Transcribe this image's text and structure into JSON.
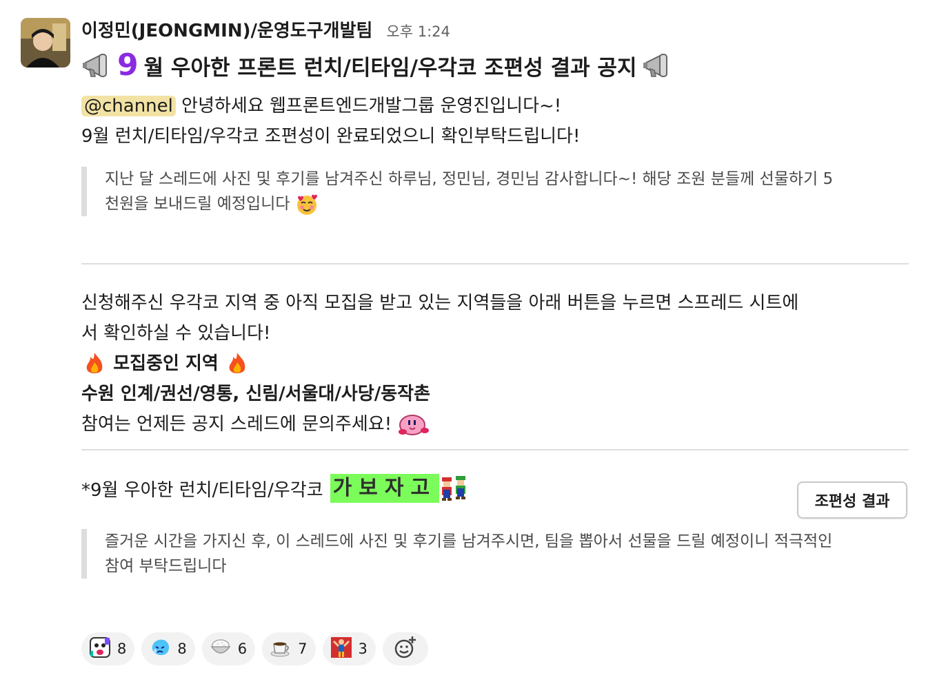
{
  "message": {
    "sender": "이정민(JEONGMIN)/운영도구개발팀",
    "time": "오후 1:24",
    "title_number": "9",
    "title_text": "월 우아한 프론트 런치/티타임/우각코 조편성 결과 공지",
    "mention": "@channel",
    "intro_line1": "안녕하세요 웹프론트엔드개발그룹 운영진입니다~!",
    "intro_line2": "9월 런치/티타임/우각코 조편성이 완료되었으니 확인부탁드립니다!",
    "quote1_line1": "지난 달 스레드에 사진 및 후기를 남겨주신 하루님, 정민님, 경민님 감사합니다~! 해당 조원 분들께 선물하기 5",
    "quote1_line2": "천원을 보내드릴 예정입니다",
    "body_line1": "신청해주신 우각코 지역 중 아직 모집을 받고 있는 지역들을 아래 버튼을 누르면 스프레드 시트에",
    "body_line2": "서 확인하실 수 있습니다!",
    "recruiting_heading": "모집중인 지역",
    "regions": "수원 인계/권선/영통, 신림/서울대/사당/동작촌",
    "inquiry": "참여는 언제든 공지 스레드에 문의주세요!",
    "attachment_text": "*9월 우아한 런치/티타임/우각코",
    "gabojago": "가보자고",
    "button_label": "조편성 결과",
    "quote2_line1": "즐거운 시간을 가지신 후, 이 스레드에 사진 및 후기를 남겨주시면, 팀을 뽑아서 선물을 드릴 예정이니 적극적인",
    "quote2_line2": "참여 부탁드립니다"
  },
  "reactions": [
    {
      "icon": "party-face-emoji",
      "count": "8"
    },
    {
      "icon": "crying-blob-emoji",
      "count": "8"
    },
    {
      "icon": "rice-bowl-emoji",
      "count": "6"
    },
    {
      "icon": "coffee-emoji",
      "count": "7"
    },
    {
      "icon": "dancing-person-emoji",
      "count": "3"
    }
  ],
  "colors": {
    "mention_bg": "#f2e3a4",
    "nine_purple": "#8a2be2",
    "gabojago_bg": "#7cfc5a",
    "quote_bar": "#dddddd"
  }
}
